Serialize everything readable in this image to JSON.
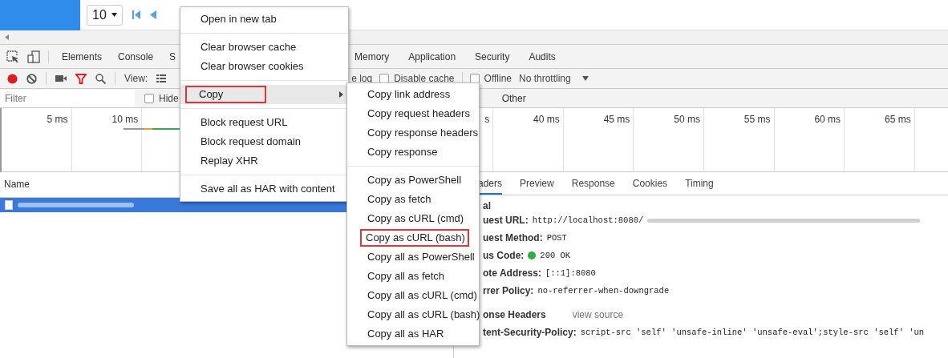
{
  "page": {
    "page_size": "10"
  },
  "devtools": {
    "tabs_left": [
      {
        "label": "Elements",
        "selected": false
      },
      {
        "label": "Console",
        "selected": false
      },
      {
        "label": "S",
        "selected": false
      }
    ],
    "tabs_right": [
      {
        "label": "Memory",
        "selected": false
      },
      {
        "label": "Application",
        "selected": false
      },
      {
        "label": "Security",
        "selected": false
      },
      {
        "label": "Audits",
        "selected": false
      }
    ],
    "toolbar": {
      "view_label": "View:",
      "preserve_log_label": "e log",
      "disable_cache": {
        "label": "Disable cache",
        "checked": false
      },
      "offline": {
        "label": "Offline",
        "checked": false
      },
      "throttling": "No throttling"
    },
    "filter": {
      "placeholder": "Filter",
      "hide": {
        "label": "Hide",
        "checked": false
      },
      "type_filter": "Other"
    },
    "overview": {
      "ticks_left": [
        "5 ms",
        "10 ms"
      ],
      "ticks_right": [
        "s",
        "40 ms",
        "45 ms",
        "50 ms",
        "55 ms",
        "60 ms",
        "65 ms"
      ]
    },
    "requests": {
      "column": "Name",
      "rows": [
        {
          "selected": true
        }
      ]
    },
    "details": {
      "tabs": [
        {
          "label": "aders",
          "selected": true
        },
        {
          "label": "Preview",
          "selected": false
        },
        {
          "label": "Response",
          "selected": false
        },
        {
          "label": "Cookies",
          "selected": false
        },
        {
          "label": "Timing",
          "selected": false
        }
      ],
      "general_title": "al",
      "general": [
        {
          "kind": "url",
          "label": "uest URL:",
          "value": "http://localhost:8080/"
        },
        {
          "kind": "text",
          "label": "uest Method:",
          "value": "POST"
        },
        {
          "kind": "status",
          "label": "us Code:",
          "value": "200 OK"
        },
        {
          "kind": "text",
          "label": "ote Address:",
          "value": "[::1]:8080"
        },
        {
          "kind": "text",
          "label": "rrer Policy:",
          "value": "no-referrer-when-downgrade"
        }
      ],
      "response_title": "onse Headers",
      "view_source": "view source",
      "response_headers": [
        {
          "label": "tent-Security-Policy:",
          "value": "script-src 'self' 'unsafe-inline' 'unsafe-eval';style-src 'self' 'un"
        }
      ]
    }
  },
  "context_menu": {
    "groups": [
      [
        {
          "label": "Open in new tab",
          "hovered": false,
          "highlighted": false,
          "submenu": false
        }
      ],
      [
        {
          "label": "Clear browser cache",
          "hovered": false,
          "highlighted": false,
          "submenu": false
        },
        {
          "label": "Clear browser cookies",
          "hovered": false,
          "highlighted": false,
          "submenu": false
        }
      ],
      [
        {
          "label": "Copy",
          "hovered": true,
          "highlighted": true,
          "submenu": true
        }
      ],
      [
        {
          "label": "Block request URL",
          "hovered": false,
          "highlighted": false,
          "submenu": false
        },
        {
          "label": "Block request domain",
          "hovered": false,
          "highlighted": false,
          "submenu": false
        },
        {
          "label": "Replay XHR",
          "hovered": false,
          "highlighted": false,
          "submenu": false
        }
      ],
      [
        {
          "label": "Save all as HAR with content",
          "hovered": false,
          "highlighted": false,
          "submenu": false
        }
      ]
    ]
  },
  "submenu": {
    "groups": [
      [
        {
          "label": "Copy link address",
          "hovered": false,
          "highlighted": false,
          "submenu": false
        },
        {
          "label": "Copy request headers",
          "hovered": false,
          "highlighted": false,
          "submenu": false
        },
        {
          "label": "Copy response headers",
          "hovered": false,
          "highlighted": false,
          "submenu": false
        },
        {
          "label": "Copy response",
          "hovered": false,
          "highlighted": false,
          "submenu": false
        }
      ],
      [
        {
          "label": "Copy as PowerShell",
          "hovered": false,
          "highlighted": false,
          "submenu": false
        },
        {
          "label": "Copy as fetch",
          "hovered": false,
          "highlighted": false,
          "submenu": false
        },
        {
          "label": "Copy as cURL (cmd)",
          "hovered": false,
          "highlighted": false,
          "submenu": false
        },
        {
          "label": "Copy as cURL (bash)",
          "hovered": false,
          "highlighted": true,
          "submenu": false
        },
        {
          "label": "Copy all as PowerShell",
          "hovered": false,
          "highlighted": false,
          "submenu": false
        },
        {
          "label": "Copy all as fetch",
          "hovered": false,
          "highlighted": false,
          "submenu": false
        },
        {
          "label": "Copy all as cURL (cmd)",
          "hovered": false,
          "highlighted": false,
          "submenu": false
        },
        {
          "label": "Copy all as cURL (bash)",
          "hovered": false,
          "highlighted": false,
          "submenu": false
        },
        {
          "label": "Copy all as HAR",
          "hovered": false,
          "highlighted": false,
          "submenu": false
        }
      ]
    ]
  }
}
